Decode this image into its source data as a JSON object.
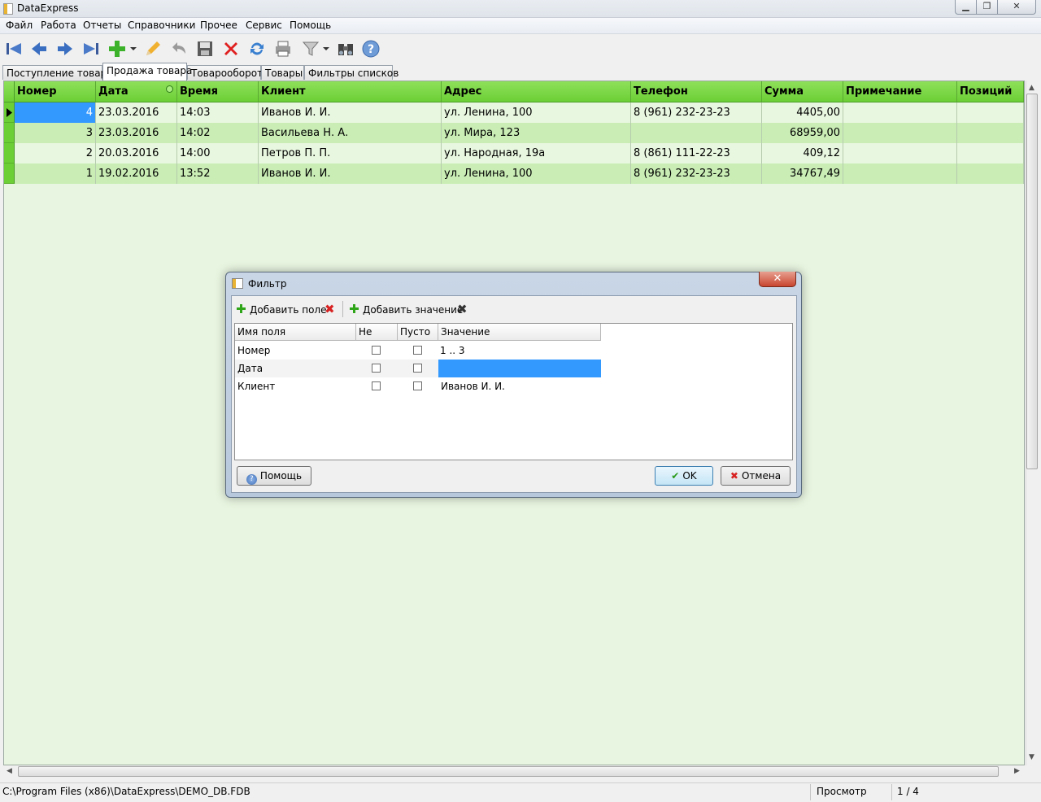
{
  "window": {
    "title": "DataExpress"
  },
  "menu": [
    "Файл",
    "Работа",
    "Отчеты",
    "Справочники",
    "Прочее",
    "Сервис",
    "Помощь"
  ],
  "tabs": [
    "Поступление товара",
    "Продажа товара",
    "Товарооборот",
    "Товары",
    "Фильтры списков"
  ],
  "active_tab": "Продажа товара",
  "grid": {
    "columns": [
      "Номер",
      "Дата",
      "Время",
      "Клиент",
      "Адрес",
      "Телефон",
      "Сумма",
      "Примечание",
      "Позиций"
    ],
    "rows": [
      [
        "4",
        "23.03.2016",
        "14:03",
        "Иванов И. И.",
        "ул. Ленина, 100",
        "8 (961) 232-23-23",
        "4405,00",
        "",
        ""
      ],
      [
        "3",
        "23.03.2016",
        "14:02",
        "Васильева Н. А.",
        "ул. Мира, 123",
        "",
        "68959,00",
        "",
        ""
      ],
      [
        "2",
        "20.03.2016",
        "14:00",
        "Петров П. П.",
        "ул. Народная, 19а",
        "8 (861) 111-22-23",
        "409,12",
        "",
        ""
      ],
      [
        "1",
        "19.02.2016",
        "13:52",
        "Иванов И. И.",
        "ул. Ленина, 100",
        "8 (961) 232-23-23",
        "34767,49",
        "",
        ""
      ]
    ]
  },
  "dialog": {
    "title": "Фильтр",
    "add_field": "Добавить поле",
    "add_value": "Добавить значение",
    "columns": [
      "Имя поля",
      "Не",
      "Пусто",
      "Значение"
    ],
    "rows": [
      {
        "field": "Номер",
        "value": "1 .. 3"
      },
      {
        "field": "Дата",
        "value": ""
      },
      {
        "field": "Клиент",
        "value": "Иванов И. И."
      }
    ],
    "help_button": "Помощь",
    "ok_button": "OK",
    "cancel_button": "Отмена"
  },
  "status": {
    "path": "C:\\Program Files (x86)\\DataExpress\\DEMO_DB.FDB",
    "mode": "Просмотр",
    "record": "1 / 4"
  },
  "colors": {
    "header_green": "#6ccf36",
    "row_light": "#e8f7df",
    "row_dark": "#c9edb5",
    "selection": "#3399ff"
  }
}
